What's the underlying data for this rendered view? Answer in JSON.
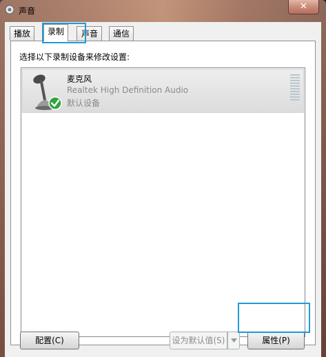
{
  "window": {
    "title": "声音",
    "close_label": "✕"
  },
  "tabs": [
    {
      "label": "播放",
      "active": false
    },
    {
      "label": "录制",
      "active": true
    },
    {
      "label": "声音",
      "active": false
    },
    {
      "label": "通信",
      "active": false
    }
  ],
  "panel": {
    "instruction": "选择以下录制设备来修改设置:"
  },
  "devices": [
    {
      "name": "麦克风",
      "driver": "Realtek High Definition Audio",
      "status": "默认设备",
      "icon": "microphone-icon",
      "badge": "default-check-icon"
    }
  ],
  "buttons": {
    "configure": "配置(C)",
    "set_default": "设为默认值(S)",
    "properties": "属性(P)"
  },
  "colors": {
    "highlight": "#1e9ad6",
    "check_green": "#2fa53a"
  }
}
